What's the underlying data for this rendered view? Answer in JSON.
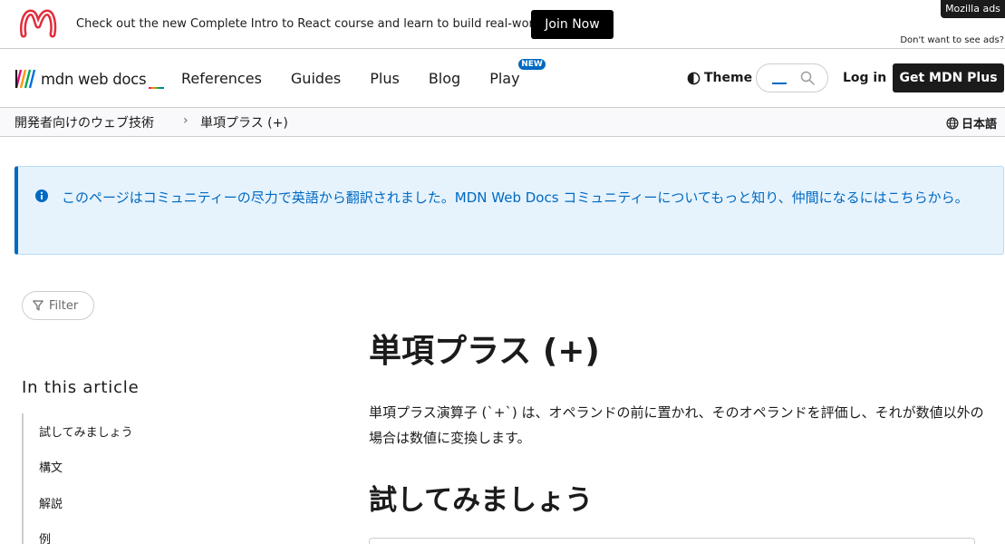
{
  "ad": {
    "text": "Check out the new Complete Intro to React course and learn to build real-world apps.",
    "button": "Join Now",
    "badge": "Mozilla ads",
    "dismiss": "Don't want to see ads?"
  },
  "header": {
    "logo_text": "mdn web docs",
    "nav": [
      {
        "label": "References"
      },
      {
        "label": "Guides"
      },
      {
        "label": "Plus"
      },
      {
        "label": "Blog"
      },
      {
        "label": "Play",
        "badge": "NEW"
      }
    ],
    "theme_label": "Theme",
    "login_label": "Log in",
    "get_plus_label": "Get MDN Plus"
  },
  "breadcrumb": {
    "items": [
      "開発者向けのウェブ技術",
      "単項プラス (+)"
    ],
    "separator": "›",
    "language": "日本語"
  },
  "notice": {
    "text": "このページはコミュニティーの尽力で英語から翻訳されました。MDN Web Docs コミュニティーについてもっと知り、仲間になるにはこちらから。"
  },
  "sidebar": {
    "filter_label": "Filter",
    "toc_title": "In this article",
    "toc": [
      "試してみましょう",
      "構文",
      "解説",
      "例"
    ]
  },
  "article": {
    "title": "単項プラス (+)",
    "intro": "単項プラス演算子 (`+`) は、オペランドの前に置かれ、そのオペランドを評価し、それが数値以外の場合は数値に変換します。",
    "section_title": "試してみましょう"
  },
  "colors": {
    "accent": "#0069c2",
    "notice_bg": "#e6f3fd",
    "text": "#1b1b1b",
    "border": "#cdcdcd"
  }
}
